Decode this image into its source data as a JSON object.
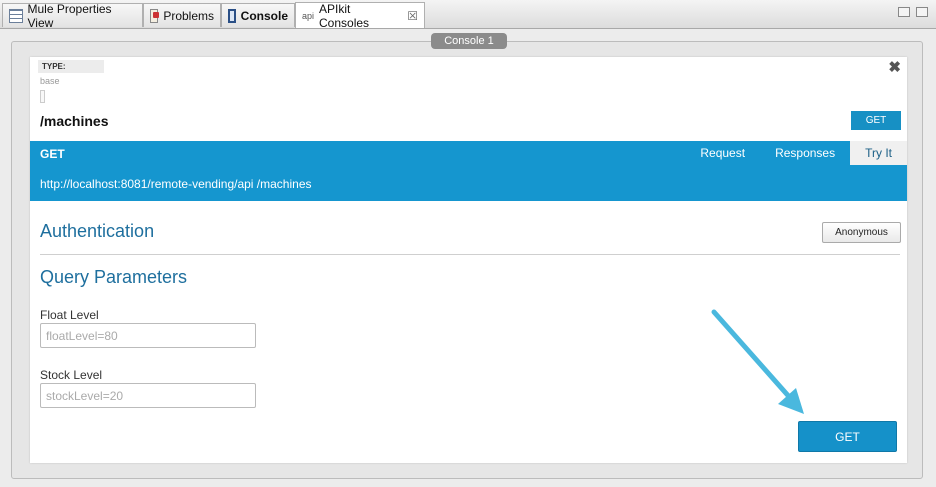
{
  "tabs": [
    {
      "label": "Mule Properties View",
      "icon": "properties-icon"
    },
    {
      "label": "Problems",
      "icon": "problems-icon"
    },
    {
      "label": "Console",
      "icon": "console-icon"
    },
    {
      "label": "APIkit Consoles",
      "icon_text": "api",
      "close": "☒"
    }
  ],
  "console_tab": "Console 1",
  "card": {
    "type_label": "TYPE:",
    "base_label": "base",
    "close_glyph": "✖",
    "resource_path": "/machines",
    "method_badge": "GET"
  },
  "bar": {
    "method": "GET",
    "tabs": [
      "Request",
      "Responses",
      "Try It"
    ],
    "active_tab": "Try It",
    "url": "http://localhost:8081/remote-vending/api /machines"
  },
  "auth": {
    "title": "Authentication",
    "button": "Anonymous"
  },
  "query": {
    "title": "Query Parameters",
    "fields": [
      {
        "label": "Float Level",
        "placeholder": "floatLevel=80"
      },
      {
        "label": "Stock Level",
        "placeholder": "stockLevel=20"
      }
    ]
  },
  "submit_label": "GET",
  "colors": {
    "accent": "#1596cf",
    "heading": "#1e6f9e",
    "arrow": "#4ab8de"
  }
}
